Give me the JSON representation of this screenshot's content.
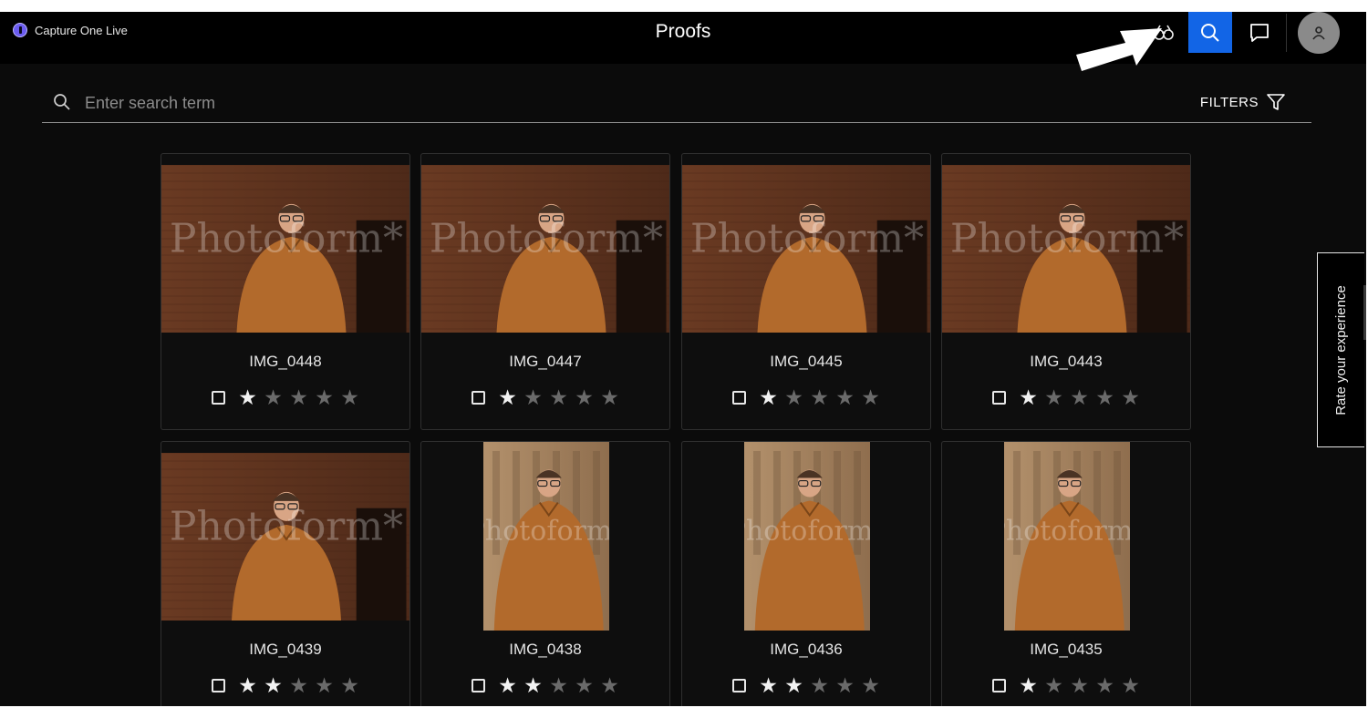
{
  "app": {
    "name": "Capture One Live"
  },
  "header": {
    "title": "Proofs"
  },
  "search": {
    "placeholder": "Enter search term",
    "value": ""
  },
  "filters": {
    "label": "FILTERS"
  },
  "rate_tab": {
    "label": "Rate your experience"
  },
  "colors": {
    "accent": "#1265e6",
    "background": "#0b0b0b",
    "topbar": "#000000"
  },
  "proofs": [
    {
      "name": "IMG_0448",
      "rating": 1,
      "max": 5,
      "orientation": "landscape",
      "checked": false
    },
    {
      "name": "IMG_0447",
      "rating": 1,
      "max": 5,
      "orientation": "landscape",
      "checked": false
    },
    {
      "name": "IMG_0445",
      "rating": 1,
      "max": 5,
      "orientation": "landscape",
      "checked": false
    },
    {
      "name": "IMG_0443",
      "rating": 1,
      "max": 5,
      "orientation": "landscape",
      "checked": false
    },
    {
      "name": "IMG_0439",
      "rating": 2,
      "max": 5,
      "orientation": "landscape",
      "checked": false
    },
    {
      "name": "IMG_0438",
      "rating": 2,
      "max": 5,
      "orientation": "portrait",
      "checked": false
    },
    {
      "name": "IMG_0436",
      "rating": 2,
      "max": 5,
      "orientation": "portrait",
      "checked": false
    },
    {
      "name": "IMG_0435",
      "rating": 1,
      "max": 5,
      "orientation": "portrait",
      "checked": false
    }
  ]
}
